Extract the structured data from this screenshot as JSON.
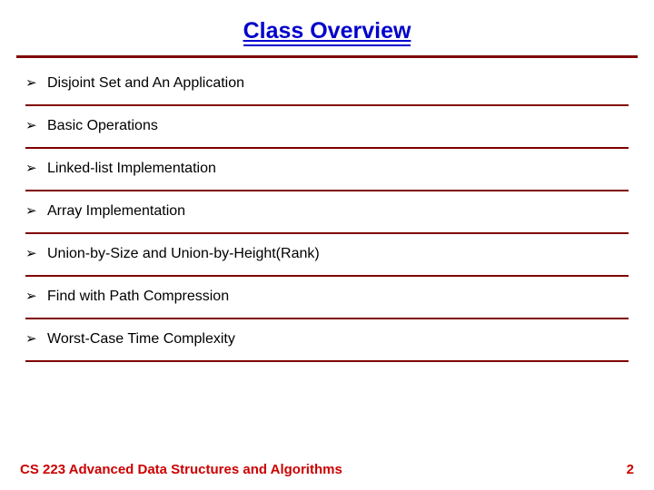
{
  "title": "Class Overview",
  "bullets": [
    {
      "text": "Disjoint Set and An Application"
    },
    {
      "text": "Basic Operations"
    },
    {
      "text": "Linked-list Implementation"
    },
    {
      "text": "Array Implementation"
    },
    {
      "text": "Union-by-Size and Union-by-Height(Rank)"
    },
    {
      "text": "Find with Path Compression"
    },
    {
      "text": "Worst-Case Time Complexity"
    }
  ],
  "footer": {
    "course": "CS 223 Advanced Data Structures and Algorithms",
    "page": "2"
  },
  "bullet_glyph": "➢"
}
